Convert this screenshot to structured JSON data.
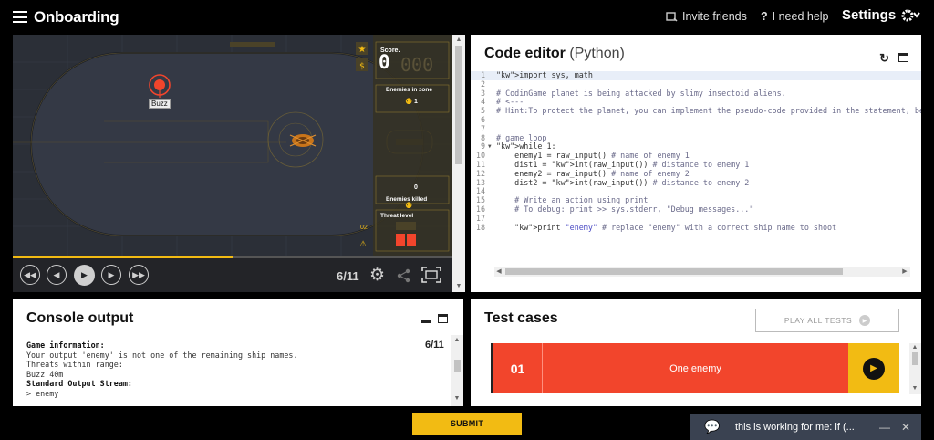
{
  "header": {
    "title": "Onboarding",
    "invite_label": "Invite friends",
    "help_label": "I need help",
    "settings_label": "Settings"
  },
  "viewer": {
    "score_label": "Score.",
    "score_value": "0",
    "enemies_in_zone_label": "Enemies in zone",
    "enemies_in_zone_value": "1",
    "enemies_killed_label": "Enemies killed",
    "enemies_killed_value": "0",
    "threat_label": "Threat level",
    "threat_index": "02",
    "enemy_tag": "Buzz",
    "frame_counter": "6/11",
    "progress": 0.5
  },
  "editor": {
    "title": "Code editor",
    "language": "(Python)",
    "lines": [
      {
        "n": "1",
        "t": "import sys, math"
      },
      {
        "n": "2",
        "t": ""
      },
      {
        "n": "3",
        "t": "# CodinGame planet is being attacked by slimy insectoid aliens."
      },
      {
        "n": "4",
        "t": "# <---"
      },
      {
        "n": "5",
        "t": "# Hint:To protect the planet, you can implement the pseudo-code provided in the statement, be"
      },
      {
        "n": "6",
        "t": ""
      },
      {
        "n": "7",
        "t": ""
      },
      {
        "n": "8",
        "t": "# game loop"
      },
      {
        "n": "9",
        "t": "while 1:"
      },
      {
        "n": "10",
        "t": "    enemy1 = raw_input() # name of enemy 1"
      },
      {
        "n": "11",
        "t": "    dist1 = int(raw_input()) # distance to enemy 1"
      },
      {
        "n": "12",
        "t": "    enemy2 = raw_input() # name of enemy 2"
      },
      {
        "n": "13",
        "t": "    dist2 = int(raw_input()) # distance to enemy 2"
      },
      {
        "n": "14",
        "t": ""
      },
      {
        "n": "15",
        "t": "    # Write an action using print"
      },
      {
        "n": "16",
        "t": "    # To debug: print >> sys.stderr, \"Debug messages...\""
      },
      {
        "n": "17",
        "t": ""
      },
      {
        "n": "18",
        "t": "    print \"enemy\" # replace \"enemy\" with a correct ship name to shoot"
      }
    ]
  },
  "console": {
    "title": "Console output",
    "counter": "6/11",
    "game_info_label": "Game information:",
    "line1": "Your output 'enemy' is not one of the remaining ship names.",
    "line2": "Threats within range:",
    "line3": "Buzz 40m",
    "stream_label": "Standard Output Stream:",
    "line4": "> enemy"
  },
  "tests": {
    "title": "Test cases",
    "play_all_label": "PLAY ALL TESTS",
    "items": [
      {
        "num": "01",
        "name": "One enemy"
      }
    ]
  },
  "submit_label": "SUBMIT",
  "chat": {
    "message": "this is working for me: if (..."
  },
  "colors": {
    "accent": "#f2bb13",
    "fail": "#f2452c",
    "chat_bg": "#3a4251"
  }
}
